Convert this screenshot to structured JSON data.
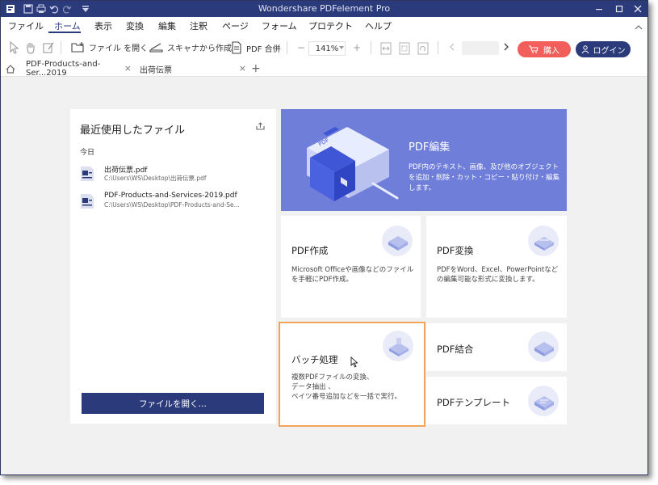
{
  "app": {
    "title": "Wondershare PDFelement Pro"
  },
  "menu": {
    "items": [
      "ファイル",
      "ホーム",
      "表示",
      "変換",
      "編集",
      "注釈",
      "ページ",
      "フォーム",
      "プロテクト",
      "ヘルプ"
    ],
    "active": "ホーム"
  },
  "toolbar": {
    "open_file": "ファイル を開く",
    "scan": "スキャナから作成",
    "merge": "PDF 合併",
    "zoom": "141%",
    "buy": "購入",
    "login": "ログイン"
  },
  "tabs": [
    {
      "label": "PDF-Products-and-Ser...2019"
    },
    {
      "label": "出荷伝票"
    }
  ],
  "recent": {
    "heading": "最近使用したファイル",
    "today_label": "今日",
    "files": [
      {
        "name": "出荷伝票.pdf",
        "path": "C:\\Users\\WS\\Desktop\\出荷伝票.pdf"
      },
      {
        "name": "PDF-Products-and-Services-2019.pdf",
        "path": "C:\\Users\\WS\\Desktop\\PDF-Products-and-Se..."
      }
    ],
    "open_button": "ファイルを開く…"
  },
  "hero": {
    "title": "PDF編集",
    "description": "PDF内のテキスト、画像、及び他のオブジェクトを追加・削除・カット・コピー・貼り付け・編集します。"
  },
  "cards": {
    "create": {
      "title": "PDF作成",
      "description": "Microsoft Officeや画像などのファイルを手軽にPDF作成。"
    },
    "convert": {
      "title": "PDF変換",
      "description": "PDFをWord、Excel、PowerPointなどの編集可能な形式に変換します。"
    },
    "batch": {
      "title": "バッチ処理",
      "lines": [
        "複数PDFファイルの変換、",
        "データ抽出 、",
        "ベイツ番号追加などを一括で実行。"
      ]
    },
    "combine": {
      "title": "PDF結合"
    },
    "template": {
      "title": "PDFテンプレート"
    }
  },
  "colors": {
    "navy": "#2b3a7a",
    "hero_blue": "#6f7ed8",
    "buy_red": "#f25e59",
    "selection_orange": "#f0a55b"
  }
}
